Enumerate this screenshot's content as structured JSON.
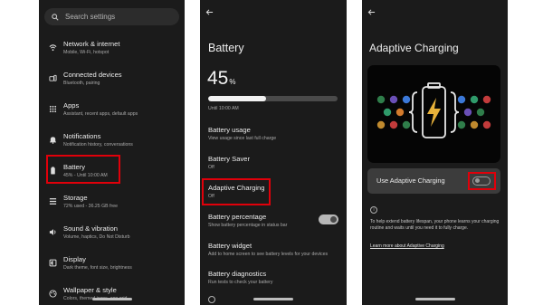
{
  "settings": {
    "search_placeholder": "Search settings",
    "items": [
      {
        "title": "Network & internet",
        "subtitle": "Mobile, Wi-Fi, hotspot",
        "icon": "wifi-icon"
      },
      {
        "title": "Connected devices",
        "subtitle": "Bluetooth, pairing",
        "icon": "connected-devices-icon"
      },
      {
        "title": "Apps",
        "subtitle": "Assistant, recent apps, default apps",
        "icon": "apps-grid-icon"
      },
      {
        "title": "Notifications",
        "subtitle": "Notification history, conversations",
        "icon": "bell-icon"
      },
      {
        "title": "Battery",
        "subtitle": "45% - Until 10:00 AM",
        "icon": "battery-icon"
      },
      {
        "title": "Storage",
        "subtitle": "72% used - 36.25 GB free",
        "icon": "storage-icon"
      },
      {
        "title": "Sound & vibration",
        "subtitle": "Volume, haptics, Do Not Disturb",
        "icon": "speaker-icon"
      },
      {
        "title": "Display",
        "subtitle": "Dark theme, font size, brightness",
        "icon": "display-icon"
      },
      {
        "title": "Wallpaper & style",
        "subtitle": "Colors, themed icons, app grid",
        "icon": "palette-icon"
      }
    ]
  },
  "battery": {
    "title": "Battery",
    "percent_value": "45",
    "percent_sign": "%",
    "level": 0.45,
    "until": "Until 10:00 AM",
    "items": [
      {
        "title": "Battery usage",
        "subtitle": "View usage since last full charge"
      },
      {
        "title": "Battery Saver",
        "subtitle": "Off"
      },
      {
        "title": "Adaptive Charging",
        "subtitle": "Off"
      },
      {
        "title": "Battery percentage",
        "subtitle": "Show battery percentage in status bar",
        "toggle": true
      },
      {
        "title": "Battery widget",
        "subtitle": "Add to home screen to see battery levels for your devices"
      },
      {
        "title": "Battery diagnostics",
        "subtitle": "Run tests to check your battery"
      }
    ]
  },
  "adaptive": {
    "title": "Adaptive Charging",
    "toggle_label": "Use Adaptive Charging",
    "toggle_on": false,
    "info_icon": "i",
    "description": "To help extend battery lifespan, your phone learns your charging routine and waits until you need it to fully charge.",
    "link": "Learn more about Adaptive Charging"
  },
  "colors": {
    "highlight": "#e0000a",
    "background": "#1b1b1b",
    "bolt": "#e8b23a"
  }
}
